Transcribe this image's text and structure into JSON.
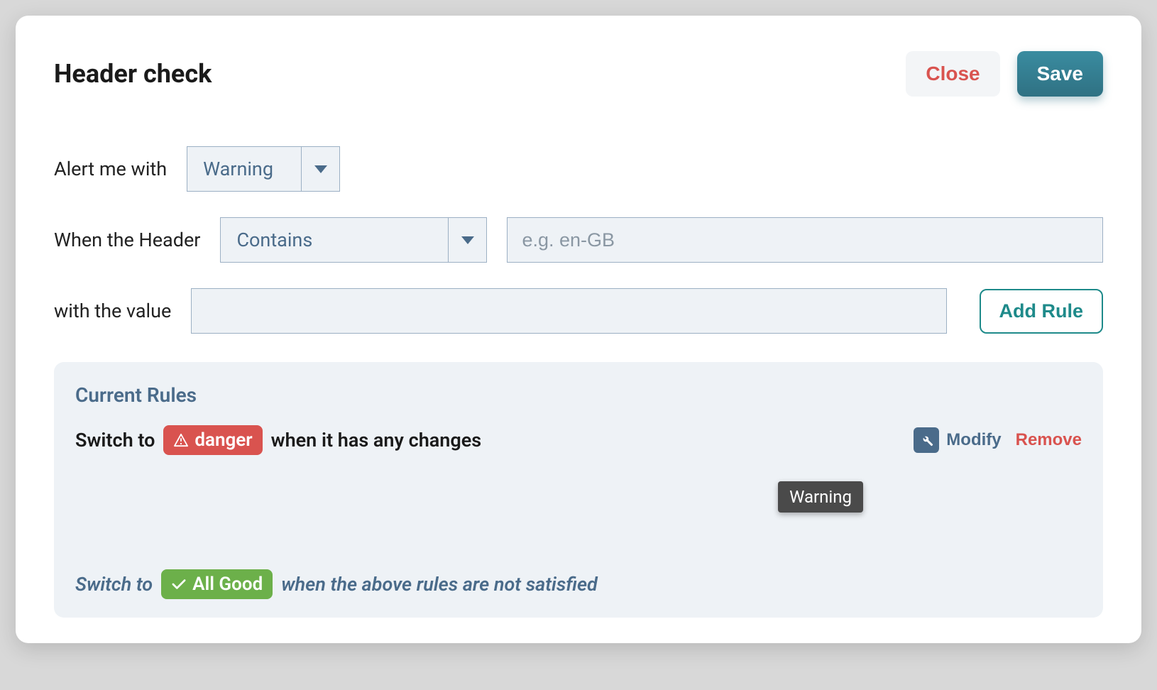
{
  "modal": {
    "title": "Header check",
    "close_label": "Close",
    "save_label": "Save"
  },
  "form": {
    "alert_label": "Alert me with",
    "alert_select": "Warning",
    "when_label": "When the Header",
    "when_select": "Contains",
    "when_placeholder": "e.g. en-GB",
    "when_value": "",
    "value_label": "with the value",
    "value_value": "",
    "add_rule_label": "Add Rule"
  },
  "rules": {
    "heading": "Current Rules",
    "switch_prefix": "Switch to",
    "items": [
      {
        "badge": "danger",
        "suffix": "when it has any changes",
        "modify_label": "Modify",
        "remove_label": "Remove"
      }
    ],
    "fallback": {
      "prefix": "Switch to",
      "badge": "All Good",
      "suffix": "when the above rules are not satisfied"
    }
  },
  "tooltip": "Warning"
}
